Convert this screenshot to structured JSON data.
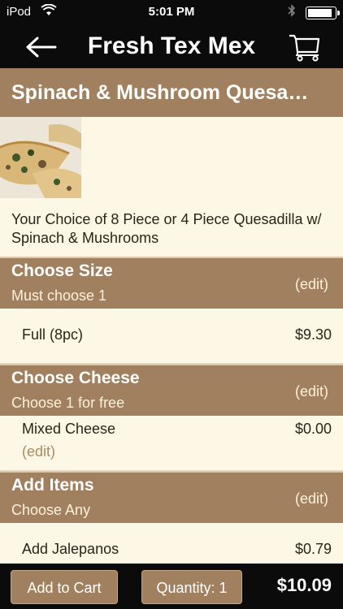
{
  "status_bar": {
    "carrier": "iPod",
    "time": "5:01 PM",
    "battery_level": 0.92
  },
  "nav": {
    "title": "Fresh Tex Mex",
    "back_icon": "back-arrow-icon",
    "cart_icon": "shopping-cart-icon"
  },
  "product": {
    "title": "Spinach & Mushroom Quesa…",
    "description": "Your Choice of 8 Piece or 4 Piece Quesadilla w/ Spinach & Mushrooms"
  },
  "sections": [
    {
      "title": "Choose Size",
      "subtitle": "Must choose 1",
      "edit": "(edit)",
      "items": [
        {
          "name": "Full (8pc)",
          "price": "$9.30"
        }
      ]
    },
    {
      "title": "Choose Cheese",
      "subtitle": "Choose 1 for free",
      "edit": "(edit)",
      "items": [
        {
          "name": "Mixed Cheese",
          "price": "$0.00",
          "edit": "(edit)"
        }
      ]
    },
    {
      "title": "Add Items",
      "subtitle": "Choose Any",
      "edit": "(edit)",
      "items": [
        {
          "name": "Add Jalepanos",
          "price": "$0.79"
        }
      ]
    }
  ],
  "bottom": {
    "add_to_cart": "Add to Cart",
    "quantity": "Quantity: 1",
    "total": "$10.09"
  },
  "colors": {
    "bar": "#0b0b0b",
    "accent": "#a0805e",
    "background": "#fdf7e6"
  }
}
